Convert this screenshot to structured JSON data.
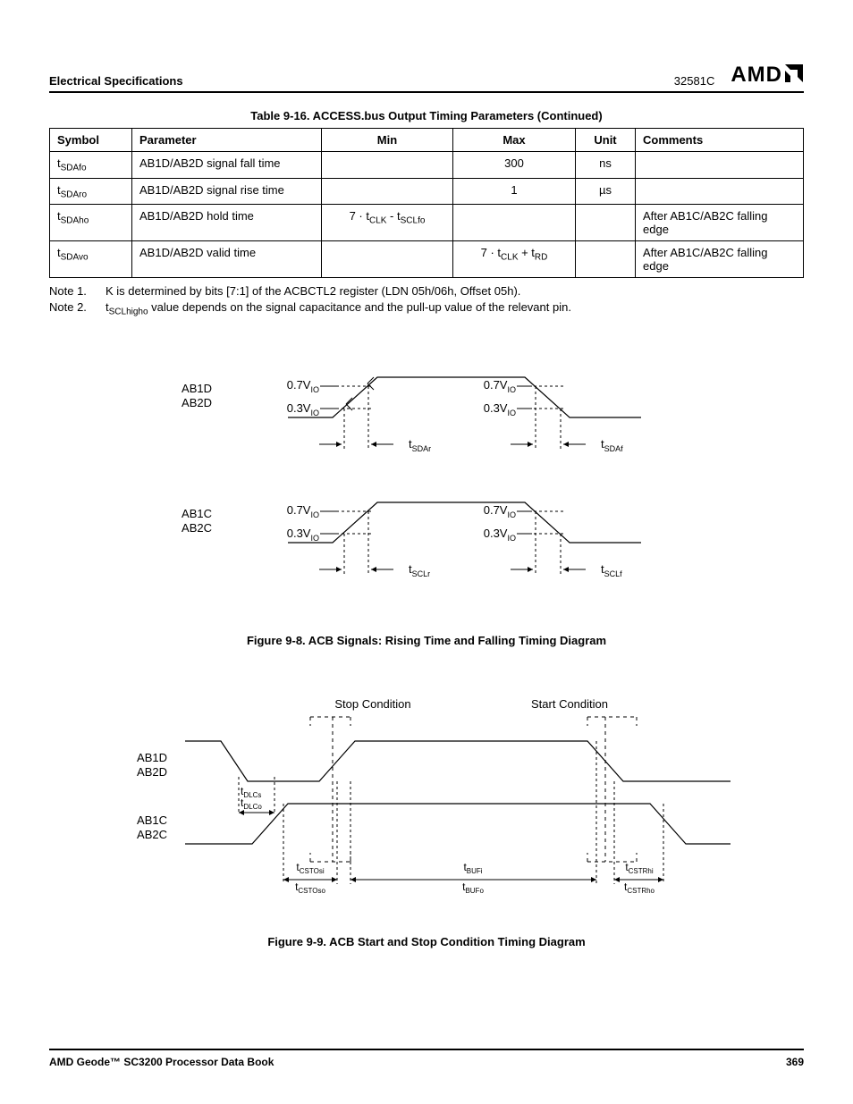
{
  "header": {
    "left": "Electrical Specifications",
    "doc_code": "32581C",
    "logo": "AMD"
  },
  "table": {
    "caption": "Table 9-16.  ACCESS.bus Output Timing Parameters  (Continued)",
    "columns": [
      "Symbol",
      "Parameter",
      "Min",
      "Max",
      "Unit",
      "Comments"
    ],
    "rows": [
      {
        "symbol_base": "t",
        "symbol_sub": "SDAfo",
        "parameter": "AB1D/AB2D signal fall time",
        "min": "",
        "max": "300",
        "unit": "ns",
        "comments": ""
      },
      {
        "symbol_base": "t",
        "symbol_sub": "SDAro",
        "parameter": "AB1D/AB2D signal rise time",
        "min": "",
        "max": "1",
        "unit": "µs",
        "comments": ""
      },
      {
        "symbol_base": "t",
        "symbol_sub": "SDAho",
        "parameter": "AB1D/AB2D hold time",
        "min": "7 · tCLK - tSCLfo",
        "max": "",
        "unit": "",
        "comments": "After AB1C/AB2C falling edge"
      },
      {
        "symbol_base": "t",
        "symbol_sub": "SDAvo",
        "parameter": "AB1D/AB2D valid time",
        "min": "",
        "max": "7 · tCLK + tRD",
        "unit": "",
        "comments": "After AB1C/AB2C falling edge"
      }
    ]
  },
  "notes": {
    "n1_label": "Note 1.",
    "n1_text": "K is determined by bits [7:1] of the ACBCTL2 register (LDN 05h/06h, Offset 05h).",
    "n2_label": "Note 2.",
    "n2_prefix": "t",
    "n2_sub": "SCLhigho",
    "n2_text": " value depends on the signal capacitance and the pull-up value of the relevant pin."
  },
  "figure1": {
    "caption": "Figure 9-8.  ACB Signals: Rising Time and Falling Timing Diagram",
    "signals": {
      "d1": "AB1D",
      "d2": "AB2D",
      "c1": "AB1C",
      "c2": "AB2C",
      "v07": "0.7V",
      "v03": "0.3V",
      "vio": "IO",
      "tsdar": "SDAr",
      "tsdaf": "SDAf",
      "tsclr": "SCLr",
      "tsclf": "SCLf"
    }
  },
  "figure2": {
    "caption": "Figure 9-9.  ACB Start and Stop Condition Timing Diagram",
    "labels": {
      "stop": "Stop Condition",
      "start": "Start Condition",
      "d1": "AB1D",
      "d2": "AB2D",
      "c1": "AB1C",
      "c2": "AB2C",
      "tdlcs": "DLCs",
      "tdlco": "DLCo",
      "tcstosi": "CSTOsi",
      "tcstoso": "CSTOso",
      "tbufi": "BUFi",
      "tbufo": "BUFo",
      "tcstrhi": "CSTRhi",
      "tcstrho": "CSTRho"
    }
  },
  "footer": {
    "left": "AMD Geode™ SC3200 Processor Data Book",
    "right": "369"
  }
}
